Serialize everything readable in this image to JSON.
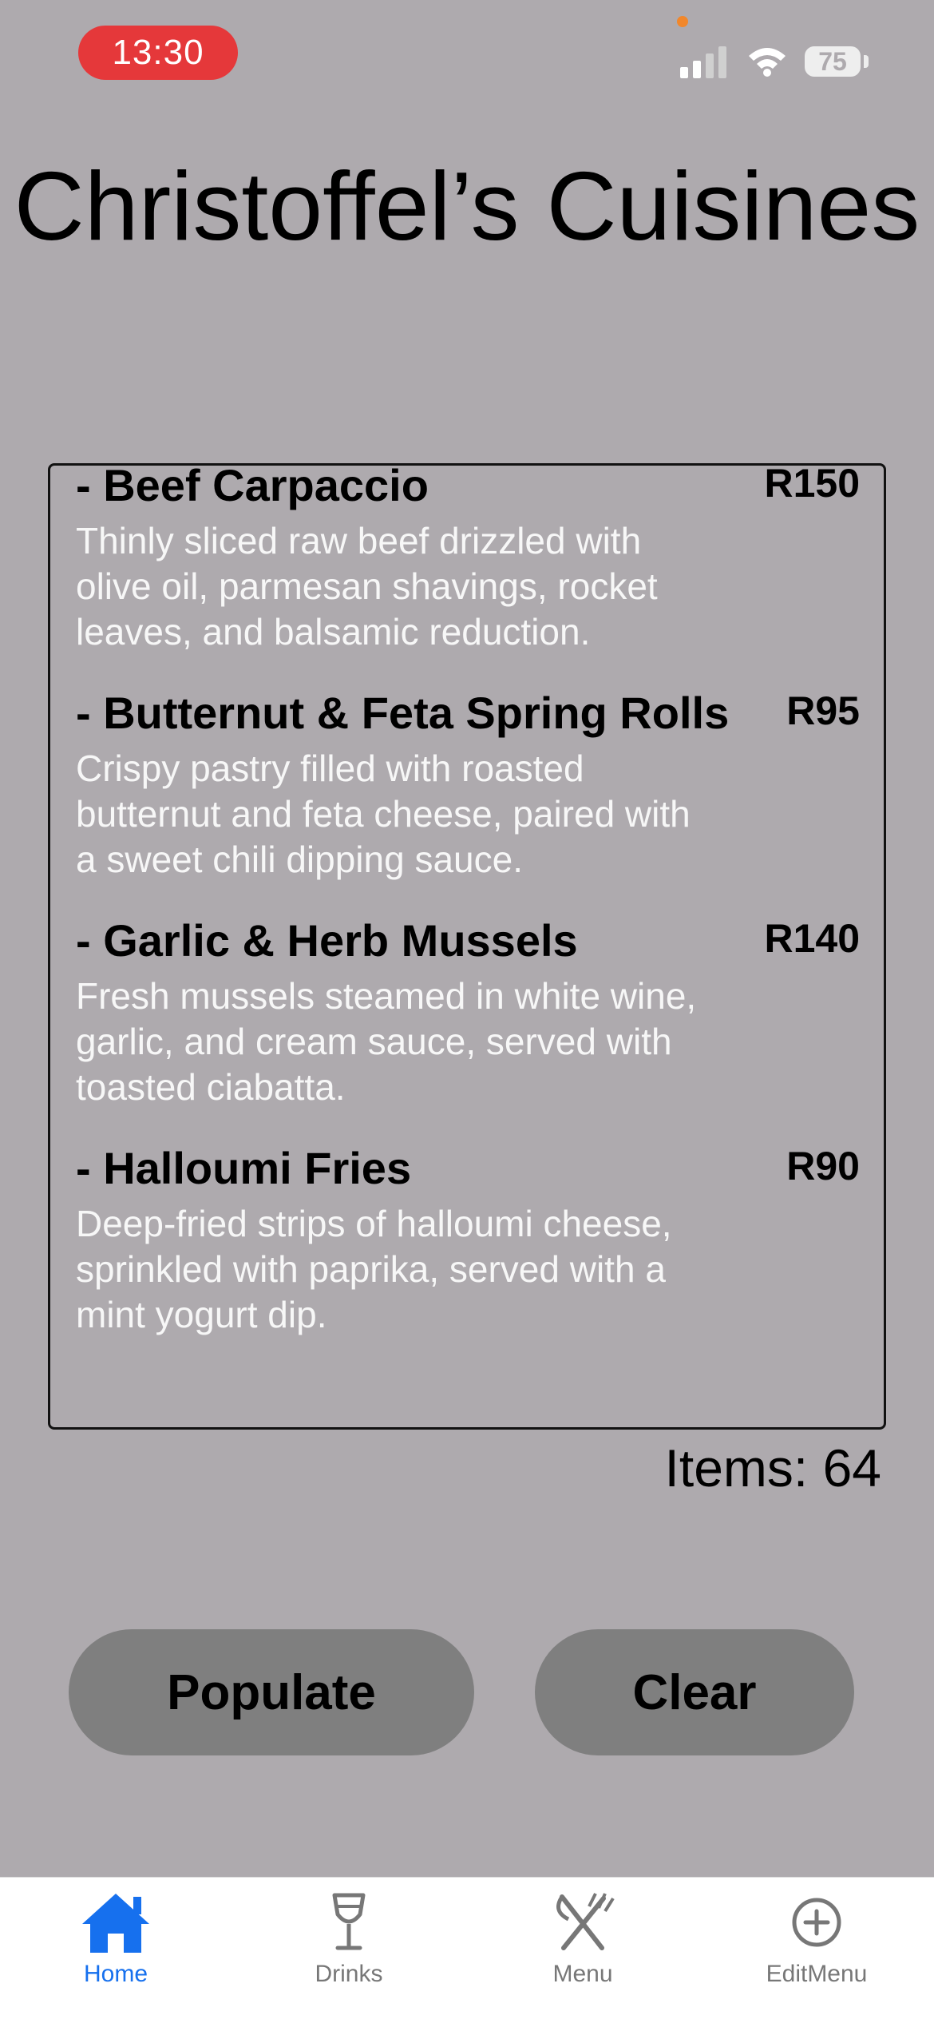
{
  "status_bar": {
    "time": "13:30",
    "battery": "75"
  },
  "title": "Christoffel’s Cuisines",
  "menu_items": [
    {
      "name": "- Beef Carpaccio",
      "price": "R150",
      "description": "Thinly sliced raw beef drizzled with olive oil, parmesan shavings, rocket leaves, and balsamic reduction."
    },
    {
      "name": "- Butternut & Feta Spring Rolls",
      "price": "R95",
      "description": "Crispy pastry filled with roasted butternut and feta cheese, paired with a sweet chili dipping sauce."
    },
    {
      "name": "- Garlic & Herb Mussels",
      "price": "R140",
      "description": "Fresh mussels steamed in white wine, garlic, and cream sauce, served with toasted ciabatta."
    },
    {
      "name": "- Halloumi Fries",
      "price": "R90",
      "description": "Deep-fried strips of halloumi cheese, sprinkled with paprika, served with a mint yogurt dip."
    }
  ],
  "items_count": "Items: 64",
  "buttons": {
    "populate": "Populate",
    "clear": "Clear"
  },
  "tabs": [
    {
      "label": "Home",
      "icon": "house-icon",
      "active": true
    },
    {
      "label": "Drinks",
      "icon": "wine-glass-icon",
      "active": false
    },
    {
      "label": "Menu",
      "icon": "fork-knife-icon",
      "active": false
    },
    {
      "label": "EditMenu",
      "icon": "plus-circle-icon",
      "active": false
    }
  ],
  "colors": {
    "background": "#aeaaae",
    "accent": "#1670ee",
    "time_pill": "#e5383a",
    "button": "#7f7f7f"
  }
}
